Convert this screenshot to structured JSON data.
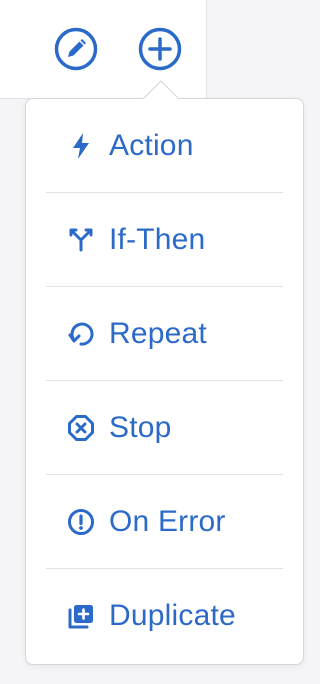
{
  "toolbar": {
    "edit_icon": "pencil-circle-icon",
    "add_icon": "plus-circle-icon"
  },
  "menu": {
    "items": [
      {
        "label": "Action",
        "icon": "bolt-icon"
      },
      {
        "label": "If-Then",
        "icon": "branch-icon"
      },
      {
        "label": "Repeat",
        "icon": "repeat-icon"
      },
      {
        "label": "Stop",
        "icon": "stop-octagon-icon"
      },
      {
        "label": "On Error",
        "icon": "error-circle-icon"
      },
      {
        "label": "Duplicate",
        "icon": "duplicate-icon"
      }
    ]
  },
  "colors": {
    "accent": "#2c6ac9",
    "divider": "#e2e2e6",
    "background": "#f5f5f7"
  }
}
